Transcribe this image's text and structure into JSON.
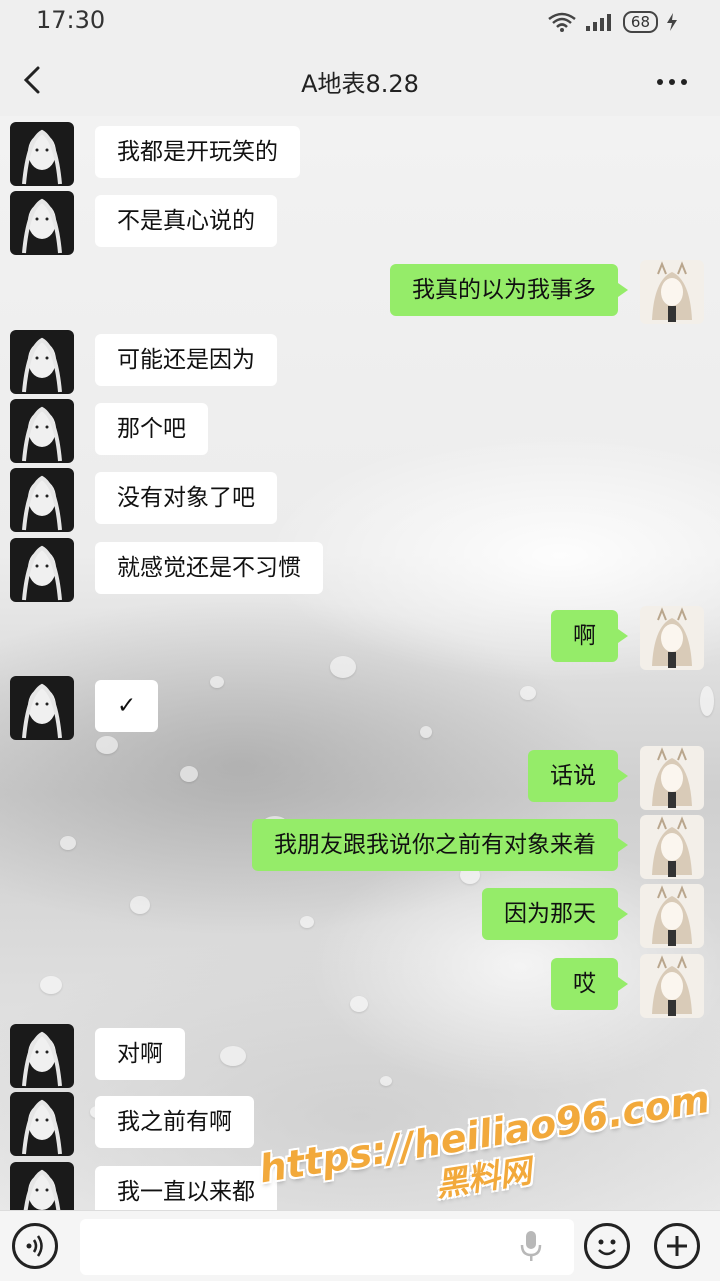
{
  "status_bar": {
    "time": "17:30",
    "battery": "68"
  },
  "header": {
    "title": "A地表8.28"
  },
  "messages": [
    {
      "side": "left",
      "text": "我都是开玩笑的"
    },
    {
      "side": "left",
      "text": "不是真心说的"
    },
    {
      "side": "right",
      "text": "我真的以为我事多"
    },
    {
      "side": "left",
      "text": "可能还是因为"
    },
    {
      "side": "left",
      "text": "那个吧"
    },
    {
      "side": "left",
      "text": "没有对象了吧"
    },
    {
      "side": "left",
      "text": "就感觉还是不习惯"
    },
    {
      "side": "right",
      "text": "啊"
    },
    {
      "side": "left",
      "text": "✓"
    },
    {
      "side": "right",
      "text": "话说"
    },
    {
      "side": "right",
      "text": "我朋友跟我说你之前有对象来着"
    },
    {
      "side": "right",
      "text": "因为那天"
    },
    {
      "side": "right",
      "text": "哎"
    },
    {
      "side": "left",
      "text": "对啊"
    },
    {
      "side": "left",
      "text": "我之前有啊"
    },
    {
      "side": "left",
      "text": "我一直以来都"
    }
  ],
  "input_bar": {
    "placeholder": ""
  },
  "watermark": {
    "line1": "https://heiliao96.com",
    "line2": "黑料网"
  },
  "colors": {
    "sent_bubble": "#95ec69",
    "received_bubble": "#ffffff",
    "watermark": "#f2a93b"
  },
  "icons": [
    "back-arrow-icon",
    "more-icon",
    "voice-icon",
    "mic-icon",
    "emoji-icon",
    "plus-icon"
  ]
}
